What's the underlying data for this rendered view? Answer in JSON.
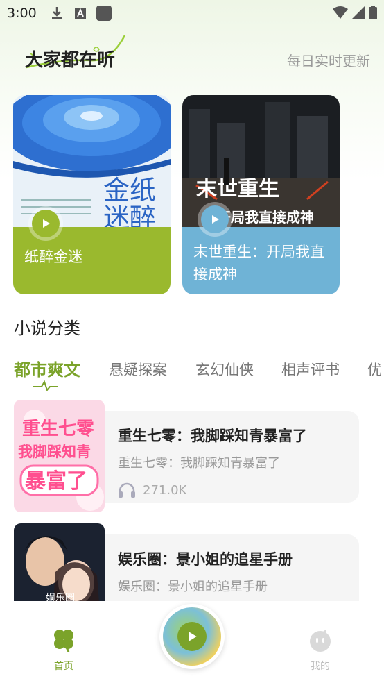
{
  "status": {
    "time": "3:00"
  },
  "header": {
    "title": "大家都在听",
    "subtitle": "每日实时更新"
  },
  "featured": [
    {
      "title": "纸醉金迷",
      "cover_text": "金纸\n迷醉",
      "color": "#9ab92e"
    },
    {
      "title": "末世重生：开局我直接成神",
      "cover_text": "末世重生",
      "cover_sub": "开局我直接成神",
      "color": "#6fb3d6"
    }
  ],
  "category": {
    "title": "小说分类",
    "tabs": [
      "都市爽文",
      "悬疑探案",
      "玄幻仙侠",
      "相声评书",
      "优"
    ],
    "active_index": 0
  },
  "list": [
    {
      "title": "重生七零：我脚踩知青暴富了",
      "subtitle": "重生七零：我脚踩知青暴富了",
      "plays": "271.0K",
      "cover_text": "重生七零 我脚踩知青 暴富了"
    },
    {
      "title": "娱乐圈：景小姐的追星手册",
      "subtitle": "娱乐圈：景小姐的追星手册",
      "cover_text": "娱乐圈"
    }
  ],
  "nav": {
    "home": "首页",
    "mine": "我的"
  },
  "colors": {
    "accent": "#7ba32a",
    "card1": "#9ab92e",
    "card2": "#6fb3d6"
  }
}
